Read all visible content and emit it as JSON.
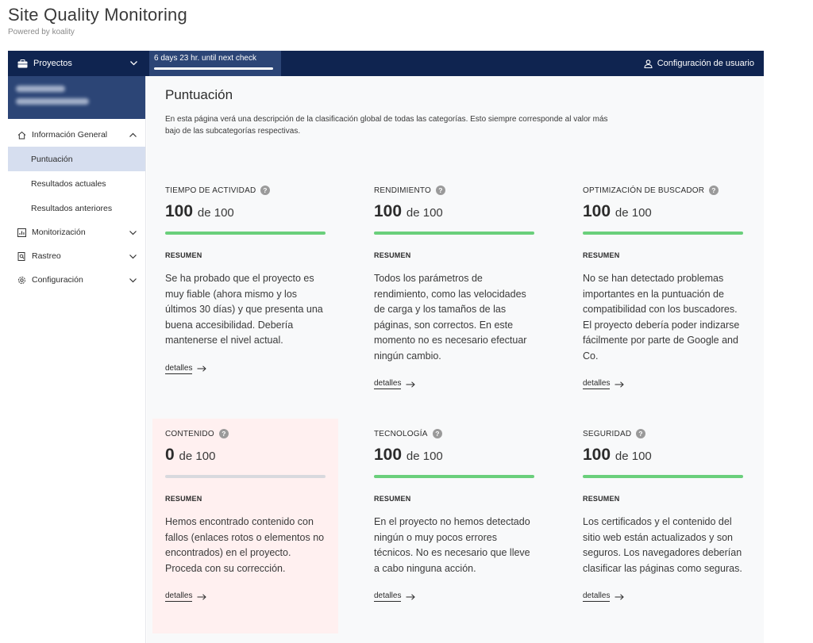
{
  "app": {
    "title": "Site Quality Monitoring",
    "subtitle": "Powered by koality"
  },
  "topbar": {
    "project_label": "Proyectos",
    "countdown": "6 days 23 hr. until next check",
    "user_settings": "Configuración de usuario"
  },
  "sidebar": {
    "overview": "Información General",
    "sub_items": [
      "Puntuación",
      "Resultados actuales",
      "Resultados anteriores"
    ],
    "monitoring": "Monitorización",
    "crawl": "Rastreo",
    "settings": "Configuración"
  },
  "main": {
    "title": "Puntuación",
    "description": "En esta página verá una descripción de la clasificación global de todas las categorías. Esto siempre corresponde al valor más bajo de las subcategorías respectivas."
  },
  "common": {
    "of_label": "de 100",
    "summary_label": "RESUMEN",
    "details_label": "detalles"
  },
  "cards": [
    {
      "title": "TIEMPO DE ACTIVIDAD",
      "score": "100",
      "score_pct": 100,
      "summary": "Se ha probado que el proyecto es muy fiable (ahora mismo y los últimos 30 días) y que presenta una buena accesibilidad. Debería mantenerse el nivel actual."
    },
    {
      "title": "RENDIMIENTO",
      "score": "100",
      "score_pct": 100,
      "summary": "Todos los parámetros de rendimiento, como las velocidades de carga y los tamaños de las páginas, son correctos. En este momento no es necesario efectuar ningún cambio."
    },
    {
      "title": "OPTIMIZACIÓN DE BUSCADOR",
      "score": "100",
      "score_pct": 100,
      "summary": "No se han detectado problemas importantes en la puntuación de compatibilidad con los buscadores. El proyecto debería poder indizarse fácilmente por parte de Google and Co."
    },
    {
      "title": "CONTENIDO",
      "score": "0",
      "score_pct": 0,
      "summary": "Hemos encontrado contenido con fallos (enlaces rotos o elementos no encontrados) en el proyecto. Proceda con su corrección."
    },
    {
      "title": "TECNOLOGÍA",
      "score": "100",
      "score_pct": 100,
      "summary": "En el proyecto no hemos detectado ningún o muy pocos errores técnicos. No es necesario que lleve a cabo ninguna acción."
    },
    {
      "title": "SEGURIDAD",
      "score": "100",
      "score_pct": 100,
      "summary": "Los certificados y el contenido del sitio web están actualizados y son seguros. Los navegadores deberían clasificar las páginas como seguras."
    }
  ],
  "colors": {
    "navy": "#0f2450",
    "accent": "#2c4576",
    "success": "#6acf7b",
    "error_bg": "#fff0f0"
  }
}
